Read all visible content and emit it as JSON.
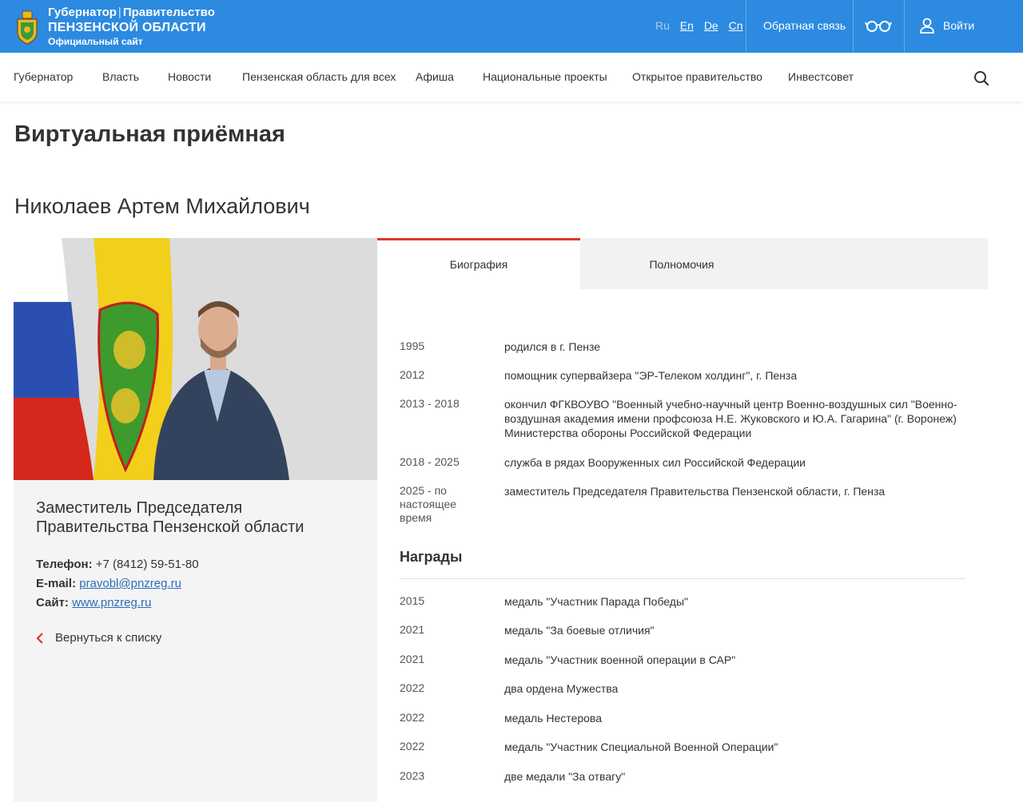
{
  "header": {
    "brand_line1_a": "Губернатор",
    "brand_line1_sep": "|",
    "brand_line1_b": "Правительство",
    "brand_line2": "ПЕНЗЕНСКОЙ ОБЛАСТИ",
    "brand_line3": "Официальный сайт",
    "languages": [
      "Ru",
      "En",
      "De",
      "Cn"
    ],
    "feedback": "Обратная связь",
    "login": "Войти",
    "color": "#2c8ae0"
  },
  "nav": {
    "items": [
      "Губернатор",
      "Власть",
      "Новости",
      "Пензенская область для всех",
      "Афиша",
      "Национальные проекты",
      "Открытое правительство",
      "Инвестсовет"
    ]
  },
  "page": {
    "title": "Виртуальная приёмная",
    "name": "Николаев Артем Михайлович"
  },
  "profile": {
    "position": "Заместитель Председателя Правительства Пензенской области",
    "phone_label": "Телефон:",
    "phone": "+7 (8412) 59-51-80",
    "email_label": "E-mail:",
    "email": "pravobl@pnzreg.ru",
    "site_label": "Сайт:",
    "site": "www.pnzreg.ru",
    "back": "Вернуться к списку"
  },
  "tabs": [
    "Биография",
    "Полномочия"
  ],
  "biography": [
    {
      "year": "1995",
      "text": "родился в г. Пензе"
    },
    {
      "year": "2012",
      "text": "помощник супервайзера \"ЭР-Телеком холдинг\", г. Пенза"
    },
    {
      "year": "2013 - 2018",
      "text": "окончил ФГКВОУВО \"Военный учебно-научный центр Военно-воздушных сил \"Военно-воздушная академия имени профсоюза Н.Е. Жуковского и Ю.А. Гагарина\" (г. Воронеж) Министерства обороны Российской Федерации"
    },
    {
      "year": "2018 - 2025",
      "text": "служба в рядах Вооруженных сил Российской Федерации"
    },
    {
      "year": "2025 - по настоящее время",
      "text": "заместитель Председателя Правительства Пензенской области, г. Пенза"
    }
  ],
  "awards_title": "Награды",
  "awards": [
    {
      "year": "2015",
      "text": "медаль \"Участник Парада Победы\""
    },
    {
      "year": "2021",
      "text": "медаль \"За боевые отличия\""
    },
    {
      "year": "2021",
      "text": "медаль \"Участник военной операции в САР\""
    },
    {
      "year": "2022",
      "text": "два ордена Мужества"
    },
    {
      "year": "2022",
      "text": "медаль Нестерова"
    },
    {
      "year": "2022",
      "text": "медаль \"Участник Специальной Военной Операции\""
    },
    {
      "year": "2023",
      "text": "две медали \"За отвагу\""
    }
  ]
}
